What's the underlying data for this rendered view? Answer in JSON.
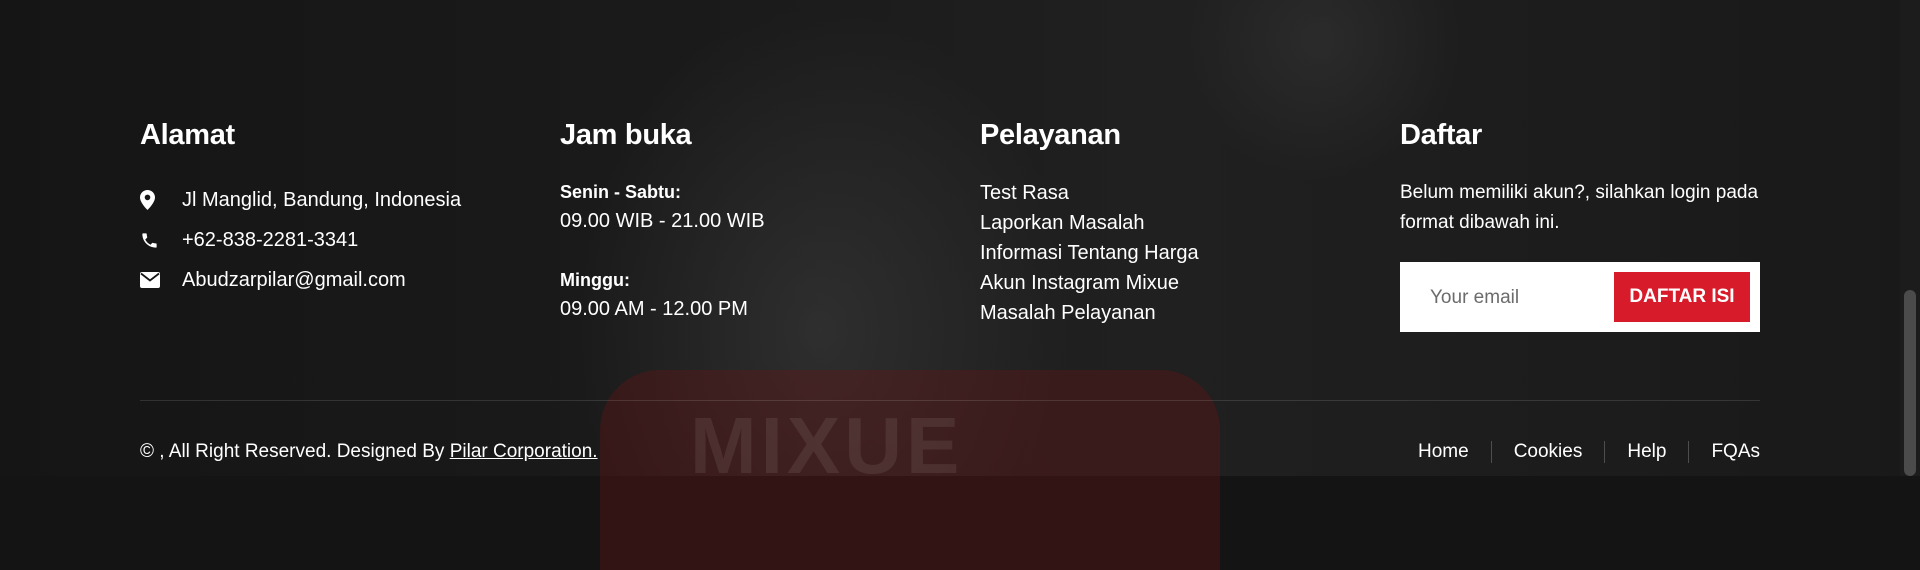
{
  "address": {
    "title": "Alamat",
    "items": [
      {
        "icon": "map-pin-icon",
        "text": "Jl Manglid, Bandung, Indonesia"
      },
      {
        "icon": "phone-icon",
        "text": "+62-838-2281-3341"
      },
      {
        "icon": "envelope-icon",
        "text": "Abudzarpilar@gmail.com"
      }
    ]
  },
  "hours": {
    "title": "Jam buka",
    "weekday_label": "Senin - Sabtu:",
    "weekday_hours": "09.00 WIB - 21.00 WIB",
    "sunday_label": "Minggu:",
    "sunday_hours": "09.00 AM - 12.00 PM"
  },
  "services": {
    "title": "Pelayanan",
    "items": [
      "Test Rasa",
      "Laporkan Masalah",
      "Informasi Tentang Harga",
      "Akun Instagram Mixue",
      "Masalah Pelayanan"
    ]
  },
  "register": {
    "title": "Daftar",
    "text": "Belum memiliki akun?, silahkan login pada format dibawah ini.",
    "placeholder": "Your email",
    "button_label": "DAFTAR ISI"
  },
  "footer": {
    "copyright": "© , All Right Reserved. Designed By",
    "designer": "Pilar Corporation.",
    "links": [
      "Home",
      "Cookies",
      "Help",
      "FQAs"
    ]
  },
  "background": {
    "cup_text": "MIXUE"
  },
  "colors": {
    "accent": "#d81b2a",
    "background": "#141414"
  }
}
